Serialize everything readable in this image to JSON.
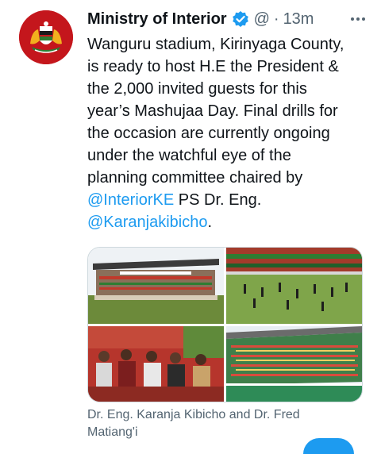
{
  "account": {
    "name": "Ministry of Interior",
    "handle": "@",
    "separator": "·",
    "time": "13m",
    "avatar_icon": "kenya-coat-of-arms-icon",
    "verified_icon": "verified-badge-icon"
  },
  "tweet": {
    "lines": [
      "Wanguru stadium, Kirinyaga County,",
      "is ready to host H.E the President &",
      "the 2,000 invited guests for this",
      "year’s Mashujaa Day. Final drills for",
      "the occasion are currently ongoing",
      "under the watchful eye of the",
      "planning committee chaired by"
    ],
    "mention1": "@InteriorKE",
    "line8_rest": " PS Dr. Eng.",
    "mention2": "@Karanjakibicho",
    "line9_rest": "."
  },
  "media": {
    "photos": [
      {
        "alt": "stadium-pavilion-photo"
      },
      {
        "alt": "field-drills-photo"
      },
      {
        "alt": "officials-seated-photo"
      },
      {
        "alt": "stands-crowd-photo"
      }
    ]
  },
  "caption": {
    "line1": "Dr. Eng. Karanja Kibicho and Dr. Fred",
    "line2": "Matiang'i"
  },
  "colors": {
    "link": "#1d9bf0",
    "secondary_text": "#536471",
    "primary_text": "#0f1419",
    "avatar_bg": "#c4161c"
  }
}
